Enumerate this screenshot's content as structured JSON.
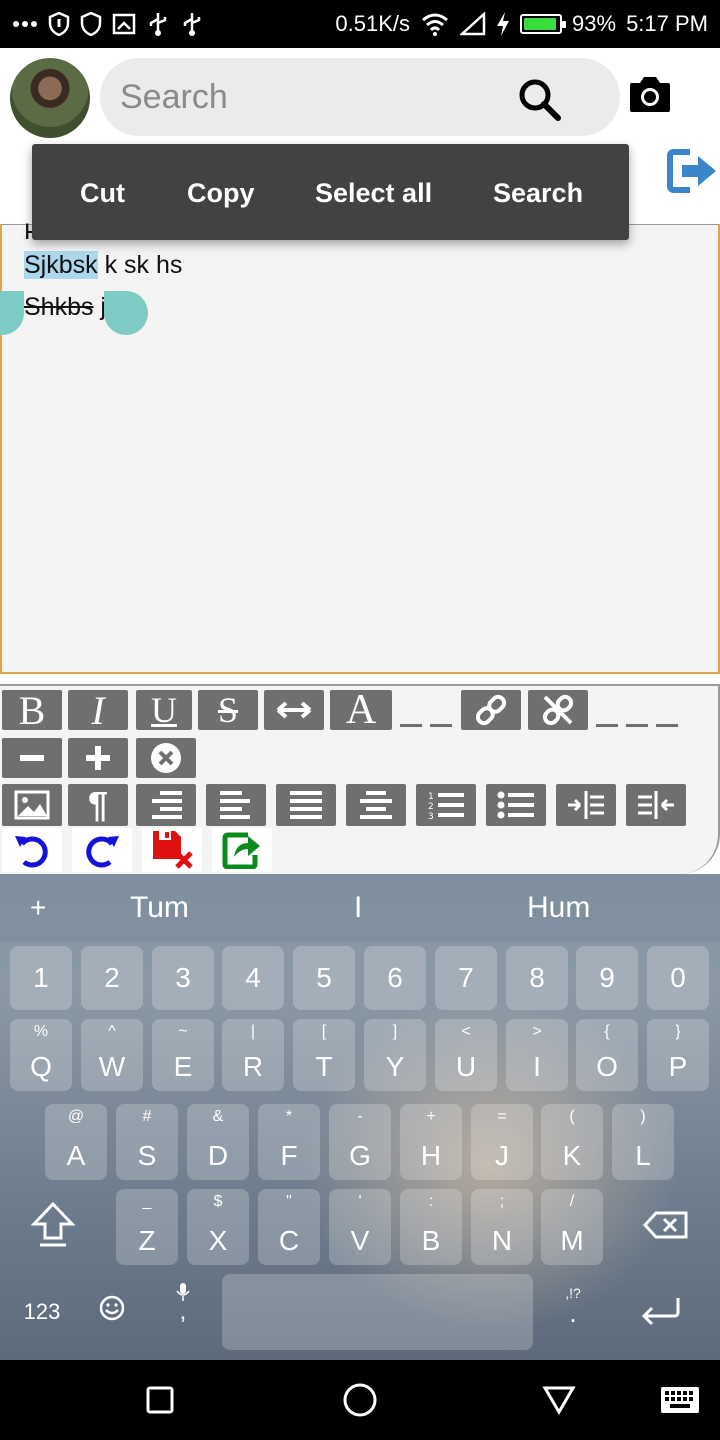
{
  "status_bar": {
    "speed": "0.51K/s",
    "battery_percent": "93%",
    "battery_level": 0.93,
    "time": "5:17 PM",
    "icons": [
      "more-icon",
      "shield-icon",
      "shield-outline-icon",
      "screenshot-icon",
      "usb-icon",
      "usb-icon",
      "wifi-icon",
      "signal-icon",
      "charging-icon",
      "battery-icon"
    ]
  },
  "header": {
    "search_placeholder": "Search",
    "avatar": "user-avatar",
    "icons": [
      "search-icon",
      "camera-icon",
      "logout-icon"
    ]
  },
  "context_menu": {
    "items": [
      "Cut",
      "Copy",
      "Select all",
      "Search"
    ]
  },
  "editor": {
    "line1_partial": "Hi",
    "line2_selected": "Sjkbsk",
    "line2_rest": " k sk hs",
    "line3_struck": "Shkbs",
    "line3_rest": " j"
  },
  "toolbar": {
    "row1": [
      "bold",
      "italic",
      "underline",
      "strikethrough",
      "horizontal-rule",
      "font",
      "link",
      "unlink"
    ],
    "row2": [
      "decrease-size",
      "increase-size",
      "clear-format"
    ],
    "row3": [
      "insert-image",
      "paragraph",
      "align-right",
      "align-left",
      "justify",
      "align-center",
      "numbered-list",
      "bullet-list",
      "indent",
      "outdent"
    ],
    "row4": [
      "undo",
      "redo",
      "discard",
      "share"
    ],
    "glyph_bold": "B",
    "glyph_italic": "I",
    "glyph_underline": "U",
    "glyph_strike": "S",
    "glyph_font": "A",
    "glyph_para": "¶"
  },
  "keyboard": {
    "suggestions": [
      "+",
      "Tum",
      "I",
      "Hum"
    ],
    "number_row": [
      "1",
      "2",
      "3",
      "4",
      "5",
      "6",
      "7",
      "8",
      "9",
      "0"
    ],
    "row_q": [
      [
        "Q",
        "%"
      ],
      [
        "W",
        "^"
      ],
      [
        "E",
        "~"
      ],
      [
        "R",
        "|"
      ],
      [
        "T",
        "["
      ],
      [
        "Y",
        "]"
      ],
      [
        "U",
        "<"
      ],
      [
        "I",
        ">"
      ],
      [
        "O",
        "{"
      ],
      [
        "P",
        "}"
      ]
    ],
    "row_a": [
      [
        "A",
        "@"
      ],
      [
        "S",
        "#"
      ],
      [
        "D",
        "&"
      ],
      [
        "F",
        "*"
      ],
      [
        "G",
        "-"
      ],
      [
        "H",
        "+"
      ],
      [
        "J",
        "="
      ],
      [
        "K",
        "("
      ],
      [
        "L",
        ")"
      ]
    ],
    "row_z": [
      [
        "Z",
        "_"
      ],
      [
        "X",
        "$"
      ],
      [
        "C",
        "\""
      ],
      [
        "V",
        "'"
      ],
      [
        "B",
        ":"
      ],
      [
        "N",
        ";"
      ],
      [
        "M",
        "/"
      ]
    ],
    "bottom": {
      "numbers": "123",
      "comma": ",",
      "period": ".",
      "period_hint": ",!?"
    }
  },
  "nav_bar": {
    "icons": [
      "recents-icon",
      "home-icon",
      "back-icon",
      "keyboard-icon"
    ]
  }
}
